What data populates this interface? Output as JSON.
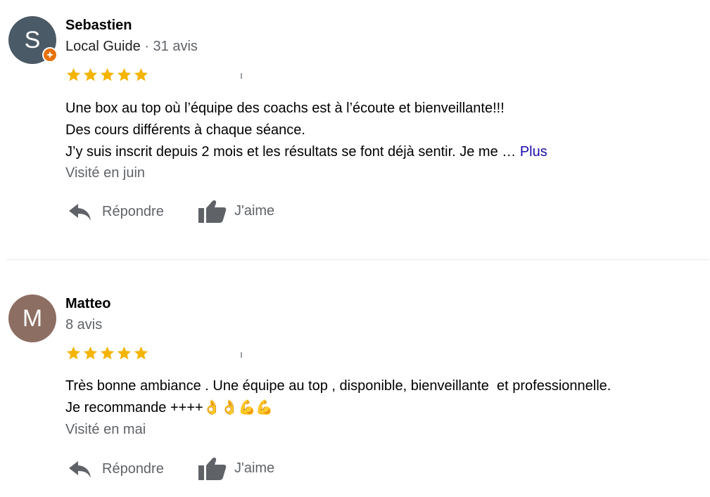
{
  "reviews": [
    {
      "avatar_initial": "S",
      "name": "Sebastien",
      "guide_label": "Local Guide",
      "review_count": "· 31 avis",
      "rating": 5,
      "text_lines": [
        "Une box au top où l’équipe des coachs est à l’écoute et bienveillante!!!",
        "Des cours différents à chaque séance.",
        "J’y suis inscrit depuis 2 mois et les résultats se font déjà sentir. Je me … "
      ],
      "more_label": "Plus",
      "visited": "Visité en juin",
      "reply_label": "Répondre",
      "like_label": "J'aime"
    },
    {
      "avatar_initial": "M",
      "name": "Matteo",
      "review_count": "8 avis",
      "rating": 5,
      "text_lines": [
        "Très bonne ambiance . Une équipe au top , disponible, bienveillante  et professionnelle.",
        "Je recommande ++++👌👌💪💪"
      ],
      "visited": "Visité en mai",
      "reply_label": "Répondre",
      "like_label": "J'aime"
    }
  ],
  "colors": {
    "star": "#F4B400",
    "link": "#1a0dab",
    "secondary_text": "#5f6368",
    "avatar_s": "#4a5a66",
    "avatar_m": "#8d6e63",
    "badge": "#e8710a"
  },
  "icons": {
    "reply": "reply-arrow-icon",
    "like": "thumbs-up-icon",
    "star": "star-icon",
    "badge": "local-guide-badge-icon"
  }
}
